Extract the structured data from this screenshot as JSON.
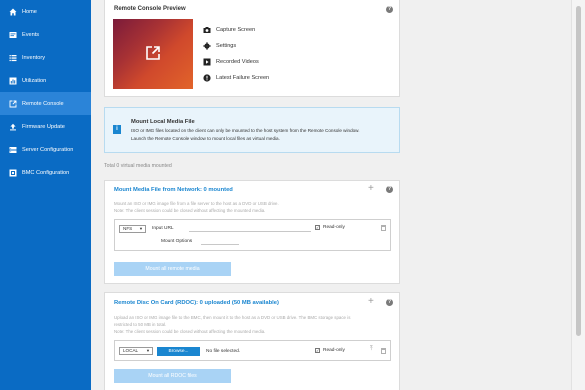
{
  "sidebar": {
    "items": [
      {
        "label": "Home",
        "icon": "home-icon"
      },
      {
        "label": "Events",
        "icon": "events-icon"
      },
      {
        "label": "Inventory",
        "icon": "inventory-icon"
      },
      {
        "label": "Utilization",
        "icon": "utilization-icon"
      },
      {
        "label": "Remote Console",
        "icon": "remote-console-icon",
        "active": true
      },
      {
        "label": "Firmware Update",
        "icon": "firmware-update-icon"
      },
      {
        "label": "Server Configuration",
        "icon": "server-configuration-icon"
      },
      {
        "label": "BMC Configuration",
        "icon": "bmc-configuration-icon"
      }
    ]
  },
  "preview": {
    "title": "Remote Console Preview",
    "help": "?",
    "links": [
      {
        "label": "Capture Screen",
        "icon": "camera-icon"
      },
      {
        "label": "Settings",
        "icon": "gear-icon"
      },
      {
        "label": "Recorded Videos",
        "icon": "video-icon"
      },
      {
        "label": "Latest Failure Screen",
        "icon": "alert-icon"
      }
    ]
  },
  "info": {
    "icon": "i",
    "title": "Mount Local Media File",
    "line1": "ISO or IMG files located on the client can only be mounted to the host system from the Remote Console window.",
    "line2": "Launch the Remote Console window to mount local files as virtual media."
  },
  "total": "Total 0 virtual media mounted",
  "network": {
    "title": "Mount Media File from Network: 0 mounted",
    "desc1": "Mount an ISO or IMG image file from a file server to the host as a DVD or USB drive.",
    "desc2": "Note: The client session could be closed without affecting the mounted media.",
    "protocol": "NFS",
    "input_url_label": "Input URL",
    "mount_options_label": "Mount Options",
    "readonly_label": "Read-only",
    "button": "Mount all remote media",
    "help": "?",
    "plus": "+"
  },
  "rdoc": {
    "title": "Remote Disc On Card (RDOC): 0 uploaded (50 MB available)",
    "desc1": "Upload an ISO or IMG image file to the BMC, then mount it to the host as a DVD or USB drive. The BMC storage space is",
    "desc2": "restricted to 50 MB in total.",
    "desc3": "Note: The client session could be closed without affecting the mounted media.",
    "location": "LOCAL",
    "browse": "Browse...",
    "no_file": "No file selected.",
    "readonly_label": "Read-only",
    "button": "Mount all RDOC files",
    "help": "?",
    "plus": "+"
  },
  "colors": {
    "sidebar": "#0a6bc4",
    "accent": "#1a86d0",
    "button_disabled": "#a9d3f5"
  }
}
